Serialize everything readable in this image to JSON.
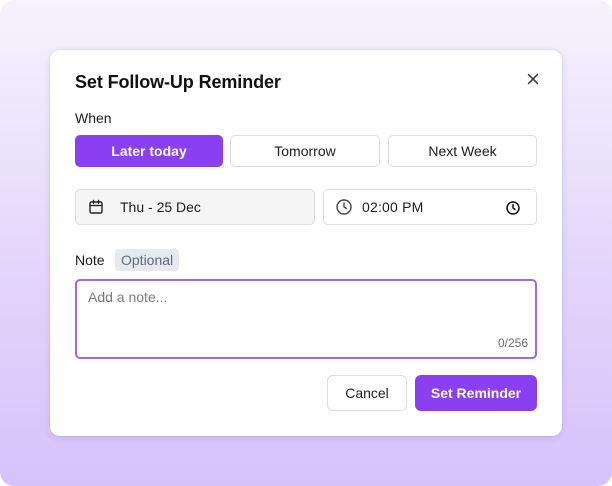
{
  "dialog": {
    "title": "Set Follow-Up Reminder",
    "close_icon": "close-icon"
  },
  "when": {
    "label": "When",
    "options": [
      {
        "label": "Later today",
        "selected": true
      },
      {
        "label": "Tomorrow",
        "selected": false
      },
      {
        "label": "Next Week",
        "selected": false
      }
    ]
  },
  "date_field": {
    "value": "Thu - 25 Dec",
    "icon": "calendar-icon"
  },
  "time_field": {
    "value": "02:00 PM",
    "icon_left": "clock-icon",
    "icon_right": "clock-icon"
  },
  "note": {
    "label": "Note",
    "badge": "Optional",
    "placeholder": "Add a note...",
    "value": "",
    "char_count": "0/256"
  },
  "actions": {
    "cancel_label": "Cancel",
    "submit_label": "Set Reminder"
  },
  "colors": {
    "accent": "#8a3ff0",
    "focus_border": "#9d66f5",
    "badge_bg": "#e6e9f0",
    "badge_text": "#5d6a80"
  }
}
